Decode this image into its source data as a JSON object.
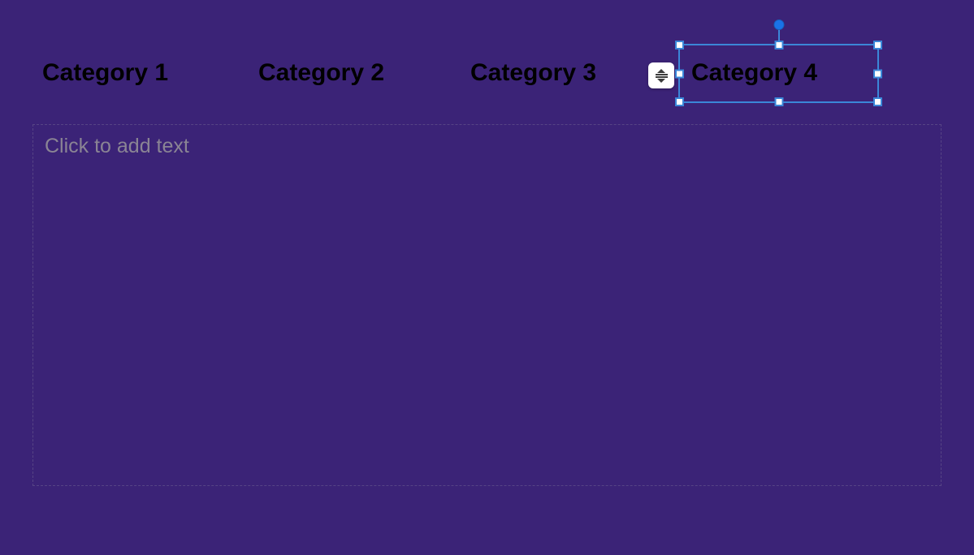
{
  "slide": {
    "background_color": "#3b2377",
    "categories": {
      "c1": "Category 1",
      "c2": "Category 2",
      "c3": "Category 3",
      "c4": "Category 4"
    },
    "content_placeholder": "Click to add text"
  },
  "selection": {
    "target": "category-4",
    "handle_color": "#3b87d8"
  }
}
